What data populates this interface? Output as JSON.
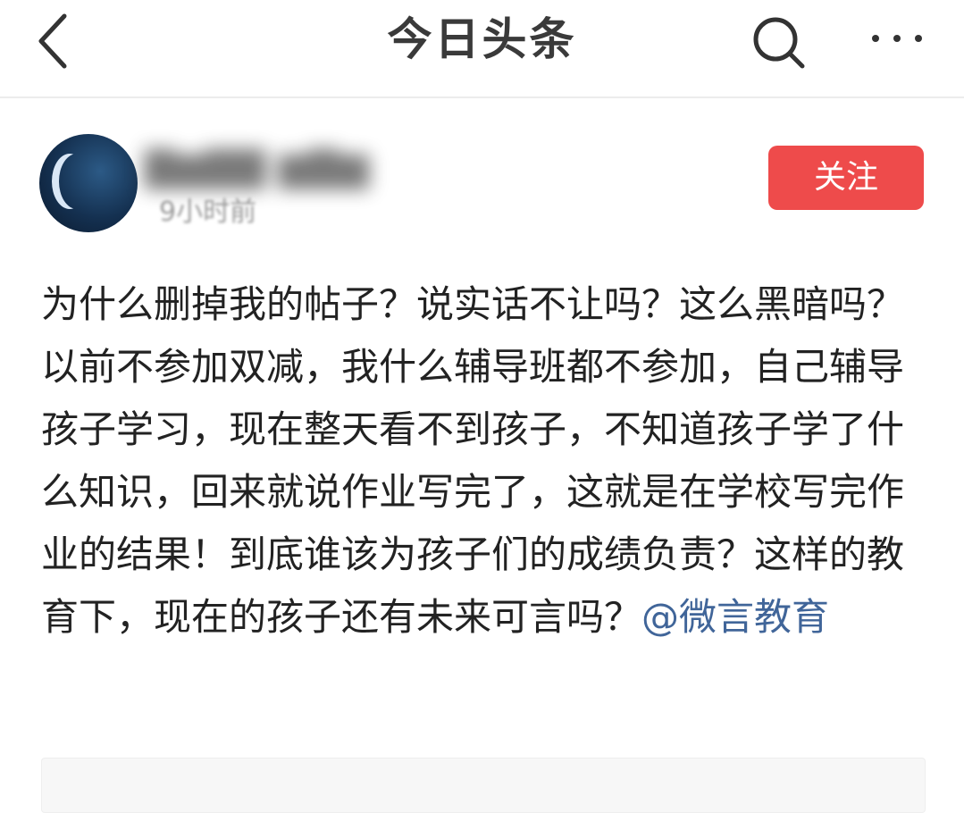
{
  "nav": {
    "title": "今日头条",
    "icons": {
      "back": "chevron-left-icon",
      "search": "search-icon",
      "more": "more-dots-icon"
    }
  },
  "author": {
    "name": "▇▆▇▇ ▆▇▆",
    "time": "9小时前",
    "avatar": "avatar-moon-night-image",
    "follow_label": "关注"
  },
  "post": {
    "body": "为什么删掉我的帖子？说实话不让吗？这么黑暗吗？以前不参加双减，我什么辅导班都不参加，自己辅导孩子学习，现在整天看不到孩子，不知道孩子学了什么知识，回来就说作业写完了，这就是在学校写完作业的结果！到底谁该为孩子们的成绩负责？这样的教育下，现在的孩子还有未来可言吗？",
    "mention": "@微言教育"
  },
  "colors": {
    "accent": "#ee4b4b",
    "mention": "#406599",
    "title": "#3a3a3a",
    "text": "#222222"
  }
}
